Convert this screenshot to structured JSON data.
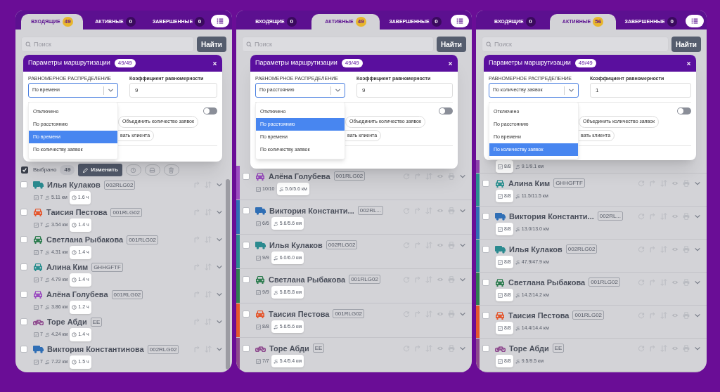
{
  "panels": [
    {
      "kind": "incoming",
      "tabs": [
        {
          "label": "ВХОДЯЩИЕ",
          "count": "49",
          "selected": true
        },
        {
          "label": "АКТИВНЫЕ",
          "count": "0",
          "selected": false
        },
        {
          "label": "ЗАВЕРШЕННЫЕ",
          "count": "0",
          "selected": false
        }
      ],
      "search": {
        "placeholder": "Поиск"
      },
      "search_button": "Найти",
      "modal": {
        "title": "Параметры маршрутизации",
        "count": "49/49",
        "distribution_label": "РАВНОМЕРНОЕ РАСПРЕДЕЛЕНИЕ",
        "distribution_value": "По времени",
        "coefficient_label": "Коэффициент равномерности",
        "coefficient_value": "9",
        "toggle": {
          "on": false
        },
        "chips": [
          "Объединить количество заявок",
          "вать клиента"
        ],
        "options": [
          {
            "label": "Отключено",
            "selected": false
          },
          {
            "label": "По расстоянию",
            "selected": false
          },
          {
            "label": "По времени",
            "selected": true
          },
          {
            "label": "По количеству заявок",
            "selected": false
          }
        ]
      },
      "selection": {
        "checked": true,
        "label": "Выбрано",
        "count": "49",
        "edit_button": "Изменить"
      },
      "rows": [
        {
          "kind": "full",
          "name": "Илья Кулаков",
          "plate": "002RLG02",
          "vehicle": {
            "kind": "truck",
            "color": "#2b8a8f"
          },
          "checked": false,
          "stats": [
            {
              "kind": "orders",
              "text": "7",
              "highlighted": false
            },
            {
              "kind": "distance",
              "text": "5.11 км",
              "highlighted": false
            },
            {
              "kind": "time",
              "text": "1.6 ч",
              "highlighted": true
            }
          ]
        },
        {
          "kind": "full",
          "name": "Таисия Пестова",
          "plate": "001RLG02",
          "vehicle": {
            "kind": "car",
            "color": "#e4572e"
          },
          "checked": false,
          "stats": [
            {
              "kind": "orders",
              "text": "7",
              "highlighted": false
            },
            {
              "kind": "distance",
              "text": "3.54 км",
              "highlighted": false
            },
            {
              "kind": "time",
              "text": "1.4 ч",
              "highlighted": true
            }
          ]
        },
        {
          "kind": "full",
          "name": "Светлана Рыбакова",
          "plate": "001RLG02",
          "vehicle": {
            "kind": "car",
            "color": "#2e7d50"
          },
          "checked": false,
          "stats": [
            {
              "kind": "orders",
              "text": "7",
              "highlighted": false
            },
            {
              "kind": "distance",
              "text": "4.31 км",
              "highlighted": false
            },
            {
              "kind": "time",
              "text": "1.4 ч",
              "highlighted": true
            }
          ]
        },
        {
          "kind": "full",
          "name": "Алина Ким",
          "plate": "GHHGFTF",
          "vehicle": {
            "kind": "car",
            "color": "#2a8f8f"
          },
          "checked": false,
          "stats": [
            {
              "kind": "orders",
              "text": "7",
              "highlighted": false
            },
            {
              "kind": "distance",
              "text": "4.79 км",
              "highlighted": false
            },
            {
              "kind": "time",
              "text": "1.4 ч",
              "highlighted": true
            }
          ]
        },
        {
          "kind": "full",
          "name": "Алёна Голубева",
          "plate": "001RLG02",
          "vehicle": {
            "kind": "car",
            "color": "#9b4dc0"
          },
          "checked": false,
          "stats": [
            {
              "kind": "orders",
              "text": "7",
              "highlighted": false
            },
            {
              "kind": "distance",
              "text": "3.86 км",
              "highlighted": false
            },
            {
              "kind": "time",
              "text": "1.2 ч",
              "highlighted": true
            }
          ]
        },
        {
          "kind": "full",
          "name": "Торе Абди",
          "plate": "EE",
          "vehicle": {
            "kind": "bike",
            "color": "#8e4a8e"
          },
          "checked": false,
          "stats": [
            {
              "kind": "orders",
              "text": "7",
              "highlighted": false
            },
            {
              "kind": "distance",
              "text": "4.24 км",
              "highlighted": false
            },
            {
              "kind": "time",
              "text": "1.4 ч",
              "highlighted": true
            }
          ]
        },
        {
          "kind": "full",
          "name": "Виктория Константинова",
          "plate": "002RLG02",
          "vehicle": {
            "kind": "truck",
            "color": "#2f6eb5"
          },
          "checked": false,
          "stats": [
            {
              "kind": "orders",
              "text": "7",
              "highlighted": false
            },
            {
              "kind": "distance",
              "text": "7.22 км",
              "highlighted": false
            },
            {
              "kind": "time",
              "text": "1.5 ч",
              "highlighted": true
            }
          ]
        }
      ]
    },
    {
      "kind": "active",
      "tabs": [
        {
          "label": "ВХОДЯЩИЕ",
          "count": "0",
          "selected": false
        },
        {
          "label": "АКТИВНЫЕ",
          "count": "49",
          "selected": true
        },
        {
          "label": "ЗАВЕРШЕННЫЕ",
          "count": "0",
          "selected": false
        }
      ],
      "search": {
        "placeholder": "Поиск"
      },
      "search_button": "Найти",
      "modal": {
        "title": "Параметры маршрутизации",
        "count": "49/49",
        "distribution_label": "РАВНОМЕРНОЕ РАСПРЕДЕЛЕНИЕ",
        "distribution_value": "По расстоянию",
        "coefficient_label": "Коэффициент равномерности",
        "coefficient_value": "9",
        "toggle": {
          "on": false
        },
        "chips": [
          "Объединить количество заявок",
          "вать клиента"
        ],
        "options": [
          {
            "label": "Отключено",
            "selected": false
          },
          {
            "label": "По расстоянию",
            "selected": true
          },
          {
            "label": "По времени",
            "selected": false
          },
          {
            "label": "По количеству заявок",
            "selected": false
          }
        ]
      },
      "rows": [
        {
          "kind": "full",
          "name": "Алёна Голубева",
          "plate": "001RLG02",
          "strip": {
            "color": "#9b4dc0"
          },
          "vehicle": {
            "kind": "car",
            "color": "#9b4dc0"
          },
          "checked": false,
          "stats": [
            {
              "kind": "orders",
              "text": "10/10",
              "highlighted": false
            },
            {
              "kind": "distance",
              "text": "5.6/5.6 км",
              "highlighted": true
            }
          ]
        },
        {
          "kind": "full",
          "name": "Виктория Константи...",
          "plate": "002RL...",
          "strip": {
            "color": "#2f6eb5"
          },
          "vehicle": {
            "kind": "truck",
            "color": "#2f6eb5"
          },
          "checked": false,
          "stats": [
            {
              "kind": "orders",
              "text": "6/6",
              "highlighted": false
            },
            {
              "kind": "distance",
              "text": "5.6/5.6 км",
              "highlighted": true
            }
          ]
        },
        {
          "kind": "full",
          "name": "Илья Кулаков",
          "plate": "002RLG02",
          "strip": {
            "color": "#2b8a8f"
          },
          "vehicle": {
            "kind": "truck",
            "color": "#2b8a8f"
          },
          "checked": false,
          "stats": [
            {
              "kind": "orders",
              "text": "9/9",
              "highlighted": false
            },
            {
              "kind": "distance",
              "text": "6.0/6.0 км",
              "highlighted": true
            }
          ]
        },
        {
          "kind": "full",
          "name": "Светлана Рыбакова",
          "plate": "001RLG02",
          "strip": {
            "color": "#2e7d50"
          },
          "vehicle": {
            "kind": "car",
            "color": "#2e7d50"
          },
          "checked": false,
          "stats": [
            {
              "kind": "orders",
              "text": "9/9",
              "highlighted": false
            },
            {
              "kind": "distance",
              "text": "5.8/5.8 км",
              "highlighted": true
            }
          ]
        },
        {
          "kind": "full",
          "name": "Таисия Пестова",
          "plate": "001RLG02",
          "strip": {
            "color": "#e4572e"
          },
          "vehicle": {
            "kind": "car",
            "color": "#e4572e"
          },
          "checked": false,
          "stats": [
            {
              "kind": "orders",
              "text": "8/8",
              "highlighted": false
            },
            {
              "kind": "distance",
              "text": "5.6/5.6 км",
              "highlighted": true
            }
          ]
        },
        {
          "kind": "full",
          "name": "Торе Абди",
          "plate": "EE",
          "strip": {
            "color": "#8e4a8e"
          },
          "vehicle": {
            "kind": "bike",
            "color": "#8e4a8e"
          },
          "checked": false,
          "stats": [
            {
              "kind": "orders",
              "text": "7/7",
              "highlighted": false
            },
            {
              "kind": "distance",
              "text": "5.4/5.4 км",
              "highlighted": true
            }
          ]
        }
      ]
    },
    {
      "kind": "active",
      "tabs": [
        {
          "label": "ВХОДЯЩИЕ",
          "count": "0",
          "selected": false
        },
        {
          "label": "АКТИВНЫЕ",
          "count": "56",
          "selected": true
        },
        {
          "label": "ЗАВЕРШЕННЫЕ",
          "count": "0",
          "selected": false
        }
      ],
      "search": {
        "placeholder": "Поиск"
      },
      "search_button": "Найти",
      "modal": {
        "title": "Параметры маршрутизации",
        "count": "49/49",
        "distribution_label": "РАВНОМЕРНОЕ РАСПРЕДЕЛЕНИЕ",
        "distribution_value": "По количеству заявок",
        "coefficient_label": "Коэффициент равномерности",
        "coefficient_value": "1",
        "toggle": {
          "on": false
        },
        "chips": [
          "Объединить количество заявок",
          "вать клиента"
        ],
        "options": [
          {
            "label": "Отключено",
            "selected": false
          },
          {
            "label": "По расстоянию",
            "selected": false
          },
          {
            "label": "По времени",
            "selected": false
          },
          {
            "label": "По количеству заявок",
            "selected": true
          }
        ]
      },
      "rows": [
        {
          "kind": "stats_only",
          "strip": {
            "color": "#8e44ad"
          },
          "stats": [
            {
              "kind": "orders",
              "text": "8/8",
              "highlighted": true
            },
            {
              "kind": "distance",
              "text": "9.1/9.1 км",
              "highlighted": false
            }
          ]
        },
        {
          "kind": "full",
          "name": "Алина Ким",
          "plate": "GHHGFTF",
          "strip": {
            "color": "#2a8f8f"
          },
          "vehicle": {
            "kind": "car",
            "color": "#2a8f8f"
          },
          "checked": false,
          "stats": [
            {
              "kind": "orders",
              "text": "8/8",
              "highlighted": true
            },
            {
              "kind": "distance",
              "text": "11.5/11.5 км",
              "highlighted": false
            }
          ]
        },
        {
          "kind": "full",
          "name": "Виктория Константи...",
          "plate": "002RL...",
          "strip": {
            "color": "#2f6eb5"
          },
          "vehicle": {
            "kind": "truck",
            "color": "#2f6eb5"
          },
          "checked": false,
          "stats": [
            {
              "kind": "orders",
              "text": "8/8",
              "highlighted": true
            },
            {
              "kind": "distance",
              "text": "13.0/13.0 км",
              "highlighted": false
            }
          ]
        },
        {
          "kind": "full",
          "name": "Илья Кулаков",
          "plate": "002RLG02",
          "strip": {
            "color": "#2b8a8f"
          },
          "vehicle": {
            "kind": "truck",
            "color": "#2b8a8f"
          },
          "checked": false,
          "stats": [
            {
              "kind": "orders",
              "text": "8/8",
              "highlighted": true
            },
            {
              "kind": "distance",
              "text": "47.9/47.9 км",
              "highlighted": false
            }
          ]
        },
        {
          "kind": "full",
          "name": "Светлана Рыбакова",
          "plate": "001RLG02",
          "strip": {
            "color": "#2e7d50"
          },
          "vehicle": {
            "kind": "car",
            "color": "#2e7d50"
          },
          "checked": false,
          "stats": [
            {
              "kind": "orders",
              "text": "8/8",
              "highlighted": true
            },
            {
              "kind": "distance",
              "text": "14.2/14.2 км",
              "highlighted": false
            }
          ]
        },
        {
          "kind": "full",
          "name": "Таисия Пестова",
          "plate": "001RLG02",
          "strip": {
            "color": "#e4572e"
          },
          "vehicle": {
            "kind": "car",
            "color": "#e4572e"
          },
          "checked": false,
          "stats": [
            {
              "kind": "orders",
              "text": "8/8",
              "highlighted": true
            },
            {
              "kind": "distance",
              "text": "14.4/14.4 км",
              "highlighted": false
            }
          ]
        },
        {
          "kind": "full",
          "name": "Торе Абди",
          "plate": "EE",
          "strip": {
            "color": "#8e4a8e"
          },
          "vehicle": {
            "kind": "bike",
            "color": "#8e4a8e"
          },
          "checked": false,
          "stats": [
            {
              "kind": "orders",
              "text": "8/8",
              "highlighted": true
            },
            {
              "kind": "distance",
              "text": "9.5/9.5 км",
              "highlighted": false
            }
          ]
        }
      ]
    }
  ]
}
